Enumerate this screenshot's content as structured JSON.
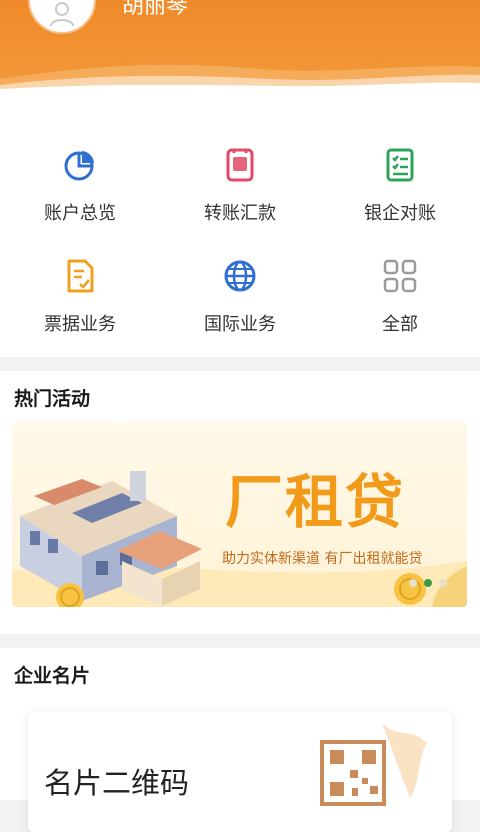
{
  "header": {
    "name": "胡丽琴"
  },
  "menu": {
    "items": [
      {
        "label": "账户总览",
        "icon": "pie-chart-icon",
        "color": "#2f6fd0"
      },
      {
        "label": "转账汇款",
        "icon": "transfer-icon",
        "color": "#e24a66"
      },
      {
        "label": "银企对账",
        "icon": "reconcile-icon",
        "color": "#2ea35a"
      },
      {
        "label": "票据业务",
        "icon": "bill-icon",
        "color": "#f0a020"
      },
      {
        "label": "国际业务",
        "icon": "globe-icon",
        "color": "#2f6fd0"
      },
      {
        "label": "全部",
        "icon": "grid-icon",
        "color": "#9a9a9a"
      }
    ]
  },
  "hot": {
    "title": "热门活动",
    "banner": {
      "title": "厂租贷",
      "subtitle": "助力实体新渠道  有厂出租就能贷",
      "slide_count": 3,
      "active_slide": 2
    }
  },
  "card_section": {
    "title": "企业名片",
    "card_title": "名片二维码"
  }
}
